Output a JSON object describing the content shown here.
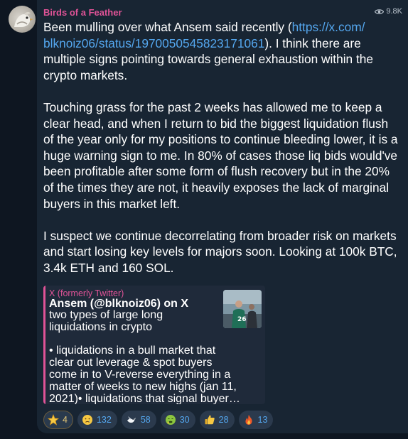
{
  "channel": {
    "name": "Birds of a Feather",
    "views": "9.8K"
  },
  "message": {
    "p1_line1_pre": "Been mulling over what Ansem said recently (",
    "p1_link_part1": "https://x.com/",
    "p1_link_part2": "blknoiz06/status/1970050545823171061",
    "p1_line2_post": ").  I think there are",
    "p1_line3": "multiple signs pointing towards general exhaustion within the",
    "p1_line4": "crypto markets.",
    "p2_line1": "Touching grass for the past 2 weeks has allowed me to keep a",
    "p2_line2": "clear head, and when I return to bid the biggest liquidation flush",
    "p2_line3": "of the year only for my positions to continue bleeding lower, it is a",
    "p2_line4": "huge warning sign to me. In 80% of cases those liq bids would've",
    "p2_line5": "been profitable after some form of flush recovery but in the 20%",
    "p2_line6": "of the times they are not, it heavily exposes the lack of marginal",
    "p2_line7": "buyers in this market left.",
    "p3_line1": "I suspect we continue decorrelating from broader risk on markets",
    "p3_line2": "and start losing key levels for majors soon. Looking at 100k BTC,",
    "p3_line3": "3.4k ETH and 160 SOL."
  },
  "preview": {
    "site": "X (formerly Twitter)",
    "title": "Ansem (@blknoiz06) on X",
    "subtitle_line1": "two types of large long",
    "subtitle_line2": "liquidations in crypto",
    "body_line1": "• liquidations in a bull market that",
    "body_line2": "clear out leverage & spot buyers",
    "body_line3": "come in to V-reverse everything in a",
    "body_line4": "matter of weeks to new highs (jan 11,",
    "body_line5": "2021)• liquidations that signal buyer…"
  },
  "reactions": [
    {
      "icon": "star-icon",
      "count": "4"
    },
    {
      "icon": "crying-face-icon",
      "count": "132"
    },
    {
      "icon": "dove-icon",
      "count": "58"
    },
    {
      "icon": "nauseated-face-icon",
      "count": "30"
    },
    {
      "icon": "thumbs-up-icon",
      "count": "28"
    },
    {
      "icon": "fire-icon",
      "count": "13"
    }
  ],
  "colors": {
    "background": "#0e1621",
    "bubble": "#182533",
    "accent_name": "#e05397",
    "link": "#54a7ef"
  }
}
